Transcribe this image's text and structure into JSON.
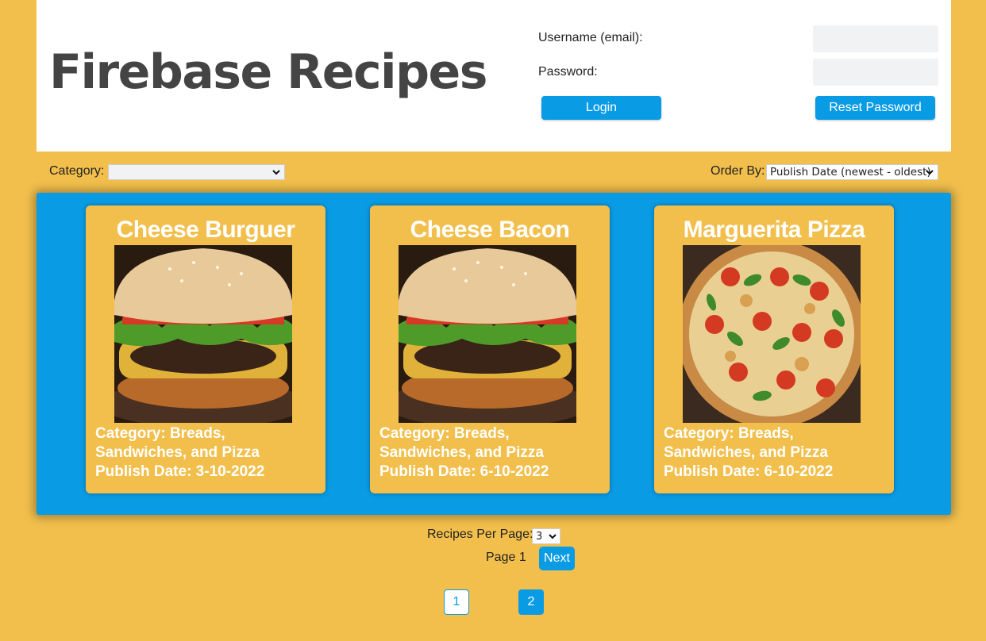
{
  "header": {
    "title": "Firebase Recipes",
    "username_label": "Username (email):",
    "password_label": "Password:",
    "username_value": "",
    "password_value": "",
    "login_button": "Login",
    "reset_password_button": "Reset Password"
  },
  "filters": {
    "category_label": "Category:",
    "category_value": "",
    "order_by_label": "Order By:",
    "order_by_value": "Publish Date (newest - oldest)"
  },
  "recipes": [
    {
      "name": "Cheese Burguer",
      "category": "Category: Breads, Sandwiches, and Pizza",
      "publish_date": "Publish Date: 3-10-2022",
      "image": "burger-photo"
    },
    {
      "name": "Cheese Bacon",
      "category": "Category: Breads, Sandwiches, and Pizza",
      "publish_date": "Publish Date: 6-10-2022",
      "image": "burger-photo"
    },
    {
      "name": "Marguerita Pizza",
      "category": "Category: Breads, Sandwiches, and Pizza",
      "publish_date": "Publish Date: 6-10-2022",
      "image": "pizza-photo"
    }
  ],
  "pagination": {
    "per_page_label": "Recipes Per Page:",
    "per_page_value": "3",
    "page_indicator": "Page 1",
    "next_button": "Next",
    "pages": [
      "1",
      "2"
    ]
  },
  "colors": {
    "background": "#f2bf4c",
    "accent": "#0a9be5",
    "header_bg": "#ffffff",
    "title_text": "#444444"
  }
}
